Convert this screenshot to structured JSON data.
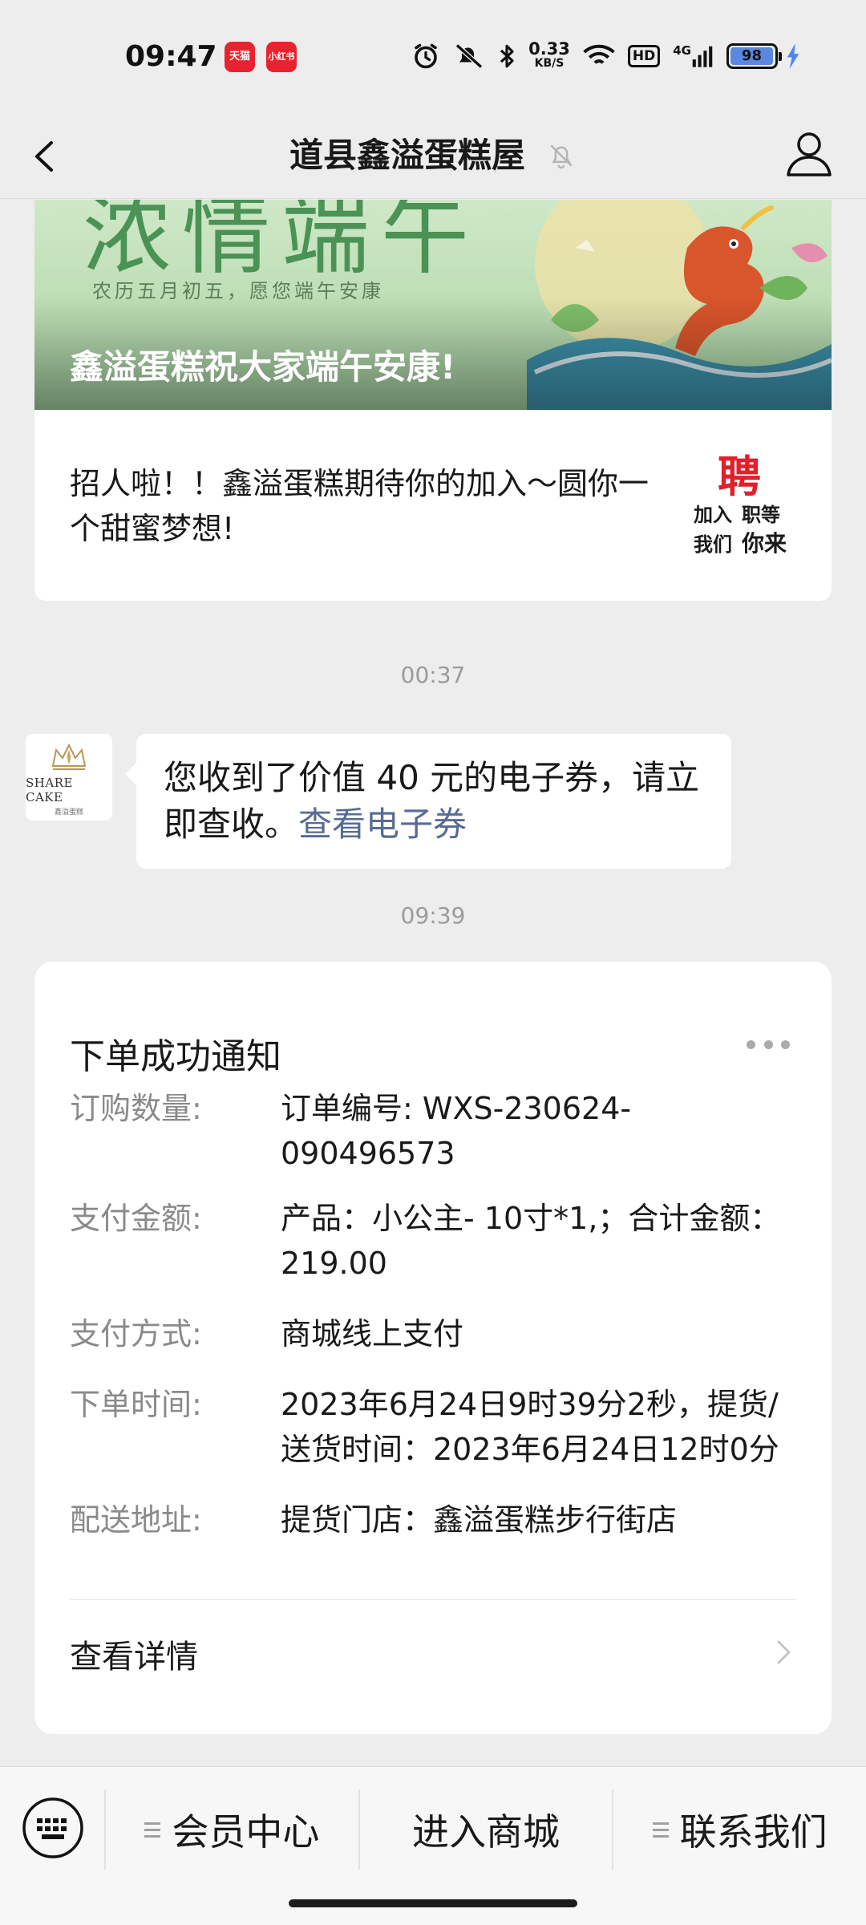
{
  "status_bar": {
    "time": "09:47",
    "badges": [
      "天猫",
      "小红书"
    ],
    "net_speed_value": "0.33",
    "net_speed_unit": "KB/S",
    "hd": "HD",
    "signal": "4G",
    "battery": "98",
    "icons": [
      "alarm-icon",
      "mute-icon",
      "bluetooth-icon",
      "wifi-icon",
      "signal-icon",
      "battery-icon",
      "charging-icon"
    ]
  },
  "nav": {
    "title": "道县鑫溢蛋糕屋",
    "back_icon": "back-arrow-icon",
    "mute_icon": "bell-muted-icon",
    "profile_icon": "person-icon"
  },
  "article": {
    "banner_headline": "浓情端午",
    "banner_subtitle": "农历五月初五，愿您端午安康",
    "banner_title": "鑫溢蛋糕祝大家端午安康!",
    "item_text": "招人啦！！鑫溢蛋糕期待你的加入～圆你一个甜蜜梦想!",
    "thumb_text": [
      "聘",
      "加入",
      "职等",
      "我们",
      "你来"
    ]
  },
  "time_labels": [
    "00:37",
    "09:39"
  ],
  "message": {
    "avatar_brand": "SHARE CAKE",
    "avatar_sub": "鑫溢蛋糕",
    "text": "您收到了价值 40 元的电子券，请立即查收。",
    "link": "查看电子券"
  },
  "order_notice": {
    "title": "下单成功通知",
    "fields": [
      {
        "label": "订购数量:",
        "value": "订单编号: WXS-230624-090496573"
      },
      {
        "label": "支付金额:",
        "value": "产品：小公主- 10寸*1,；合计金额：219.00"
      },
      {
        "label": "支付方式:",
        "value": "商城线上支付"
      },
      {
        "label": "下单时间:",
        "value": "2023年6月24日9时39分2秒，提货/送货时间：2023年6月24日12时0分"
      },
      {
        "label": "配送地址:",
        "value": "提货门店：鑫溢蛋糕步行街店"
      }
    ],
    "detail_label": "查看详情"
  },
  "bottom_menu": {
    "keyboard_icon": "keyboard-icon",
    "items": [
      "会员中心",
      "进入商城",
      "联系我们"
    ]
  },
  "colors": {
    "background": "#ededed",
    "link": "#576b95",
    "label_gray": "#8a8a8a",
    "charging": "#4f86f0"
  }
}
